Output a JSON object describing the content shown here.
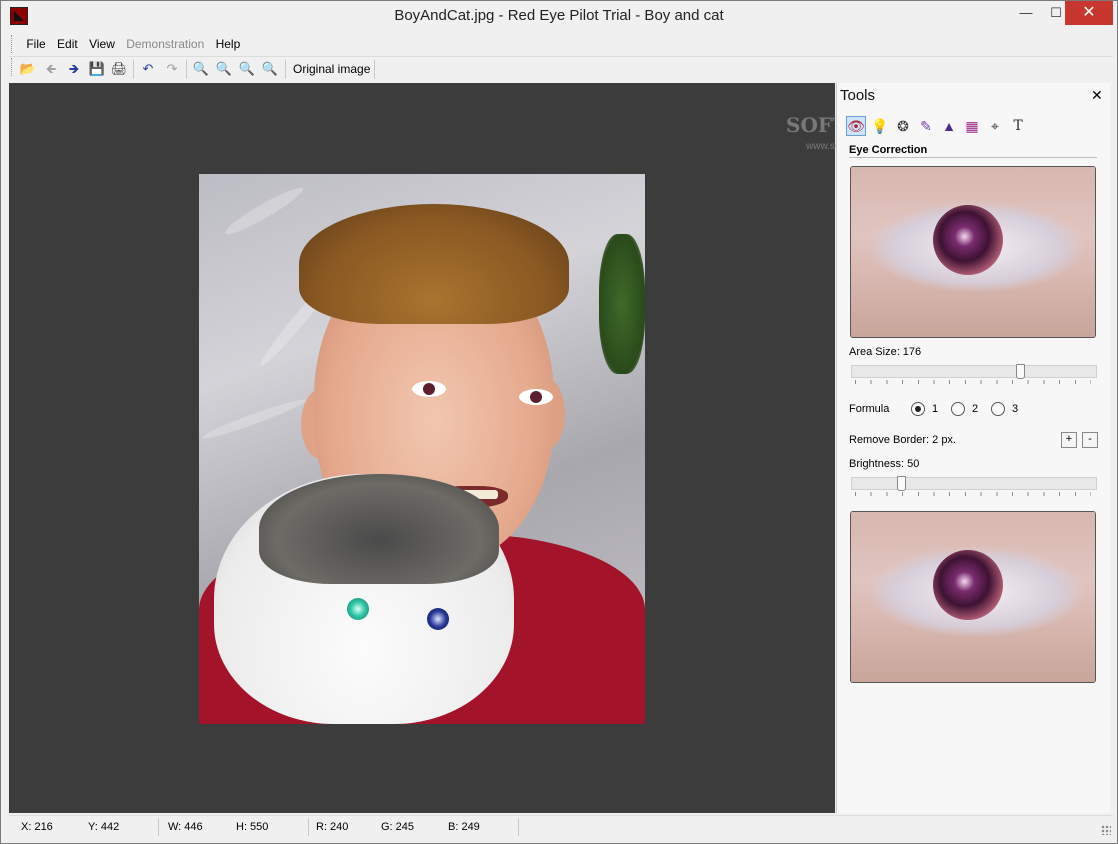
{
  "window": {
    "title": "BoyAndCat.jpg - Red Eye Pilot Trial - Boy and cat"
  },
  "menu": {
    "items": [
      "File",
      "Edit",
      "View",
      "Demonstration",
      "Help"
    ]
  },
  "toolbar": {
    "icons": [
      "open-folder-icon",
      "back-arrow-icon",
      "forward-arrow-icon",
      "save-disk-icon",
      "print-icon",
      "undo-icon",
      "redo-icon",
      "zoom-in-icon",
      "zoom-out-icon",
      "zoom-fit-icon",
      "zoom-actual-icon"
    ],
    "original_label": "Original image"
  },
  "tools": {
    "title": "Tools",
    "tool_icons": [
      "eye-correction-icon",
      "bulb-icon",
      "aperture-icon",
      "brush-icon",
      "triangle-icon",
      "color-swatch-icon",
      "crop-icon",
      "text-icon"
    ],
    "section_title": "Eye Correction",
    "area_size_label": "Area Size: 176",
    "area_size_value": 176,
    "formula_label": "Formula",
    "formula_options": [
      "1",
      "2",
      "3"
    ],
    "formula_selected": "1",
    "remove_border_label": "Remove Border: 2 px.",
    "plus_label": "+",
    "minus_label": "-",
    "brightness_label": "Brightness: 50",
    "brightness_value": 50
  },
  "status": {
    "x": "X: 216",
    "y": "Y: 442",
    "w": "W: 446",
    "h": "H: 550",
    "r": "R: 240",
    "g": "G: 245",
    "b": "B: 249"
  },
  "watermark": {
    "text": "SOFT",
    "sub": "www.so"
  }
}
